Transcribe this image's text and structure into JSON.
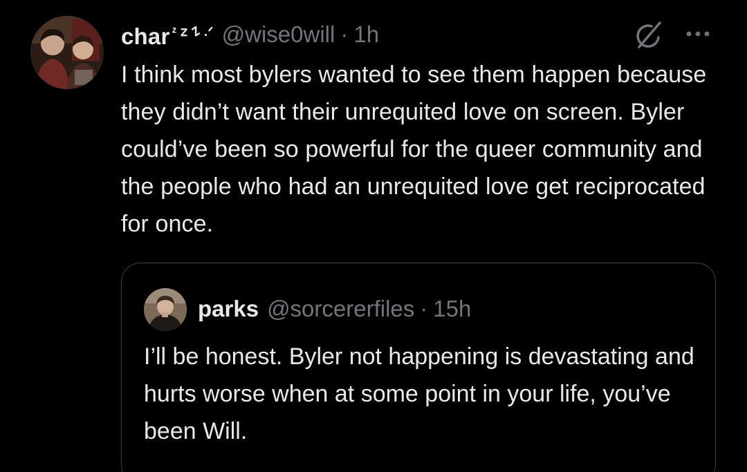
{
  "post": {
    "author": {
      "display_name": "char",
      "name_decoration": "ᶻ 𝗓 𐰁 .ᐟ",
      "handle": "@wise0will",
      "avatar": "avatar-photo-two-boys"
    },
    "separator": "·",
    "time": "1h",
    "text": "I think most bylers wanted to see them happen because they didn’t want their unrequited love on screen. Byler could’ve been so powerful for the queer community and the people who had an unrequited love get reciprocated for once.",
    "icons": {
      "grok": "grok-slash-icon",
      "more": "more-dots-icon"
    }
  },
  "quoted_post": {
    "author": {
      "display_name": "parks",
      "handle": "@sorcererfiles",
      "avatar": "avatar-photo-boy"
    },
    "separator": "·",
    "time": "15h",
    "text": "I’ll be honest. Byler not happening is devastating and hurts worse when at some point in your life, you’ve been Will."
  },
  "colors": {
    "background": "#000000",
    "primary_text": "#e7e9ea",
    "secondary_text": "#71767b",
    "border": "#3e4144"
  }
}
